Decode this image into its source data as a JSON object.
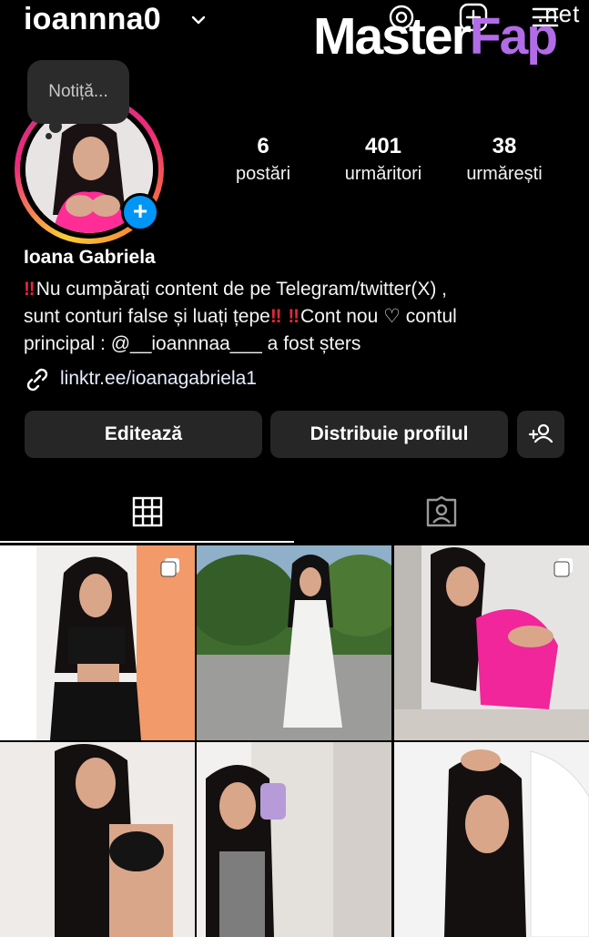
{
  "header": {
    "username": "ioannna0",
    "icons": [
      "chevron-down-icon",
      "threads-icon",
      "new-post-icon",
      "menu-icon"
    ]
  },
  "watermark": {
    "part1": "Master",
    "part2": "Fap",
    "suffix": ".net"
  },
  "note": {
    "placeholder": "Notiță..."
  },
  "stats": [
    {
      "value": "6",
      "label": "postări"
    },
    {
      "value": "401",
      "label": "urmăritori"
    },
    {
      "value": "38",
      "label": "urmărești"
    }
  ],
  "profile": {
    "name": "Ioana Gabriela",
    "bio_line1": "Nu cumpărați content de pe Telegram/twitter(X) ,",
    "bio_line2a": "sunt conturi false și luați țepe",
    "bio_line2b": "Cont nou",
    "bio_line2c": "contul",
    "bio_line3": "principal : @__ioannnaa___ a fost șters",
    "link": "linktr.ee/ioanagabriela1"
  },
  "buttons": {
    "edit": "Editează",
    "share": "Distribuie profilul"
  },
  "tabs": [
    "grid-tab",
    "tagged-tab"
  ],
  "colors": {
    "accent_blue": "#0095f6",
    "button_bg": "#262626",
    "warning_red": "#e0263c"
  },
  "posts": [
    {
      "multi": true
    },
    {
      "multi": false
    },
    {
      "multi": true
    },
    {
      "multi": false
    },
    {
      "multi": false
    },
    {
      "multi": false
    }
  ]
}
